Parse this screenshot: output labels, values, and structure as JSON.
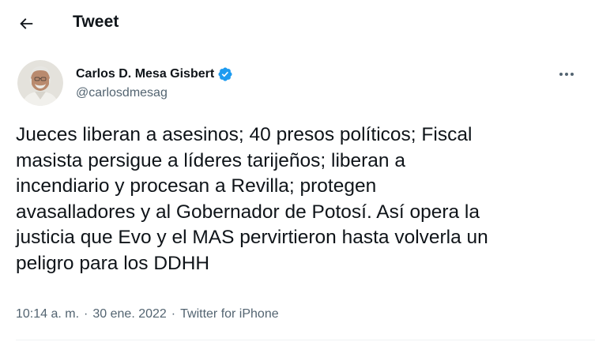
{
  "header": {
    "back_icon": "arrow-left-icon",
    "title": "Tweet"
  },
  "author": {
    "display_name": "Carlos D. Mesa Gisbert",
    "handle": "@carlosdmesag",
    "verified_icon": "verified-badge-icon",
    "verified_color": "#1d9bf0"
  },
  "more_icon": "more-dots-icon",
  "tweet": {
    "text": "Jueces liberan a asesinos; 40 presos políticos; Fiscal\nmasista persigue a líderes tarijeños; liberan a\nincendiario y procesan a Revilla; protegen\navasalladores y al Gobernador de Potosí. Así opera la\njusticia que Evo y el MAS pervirtieron hasta volverla un\npeligro para los DDHH"
  },
  "meta": {
    "time": "10:14 a. m.",
    "separator": "·",
    "date": "30 ene. 2022",
    "source": "Twitter for iPhone"
  },
  "colors": {
    "text": "#0f1419",
    "secondary": "#536471",
    "divider": "#eff3f4"
  }
}
